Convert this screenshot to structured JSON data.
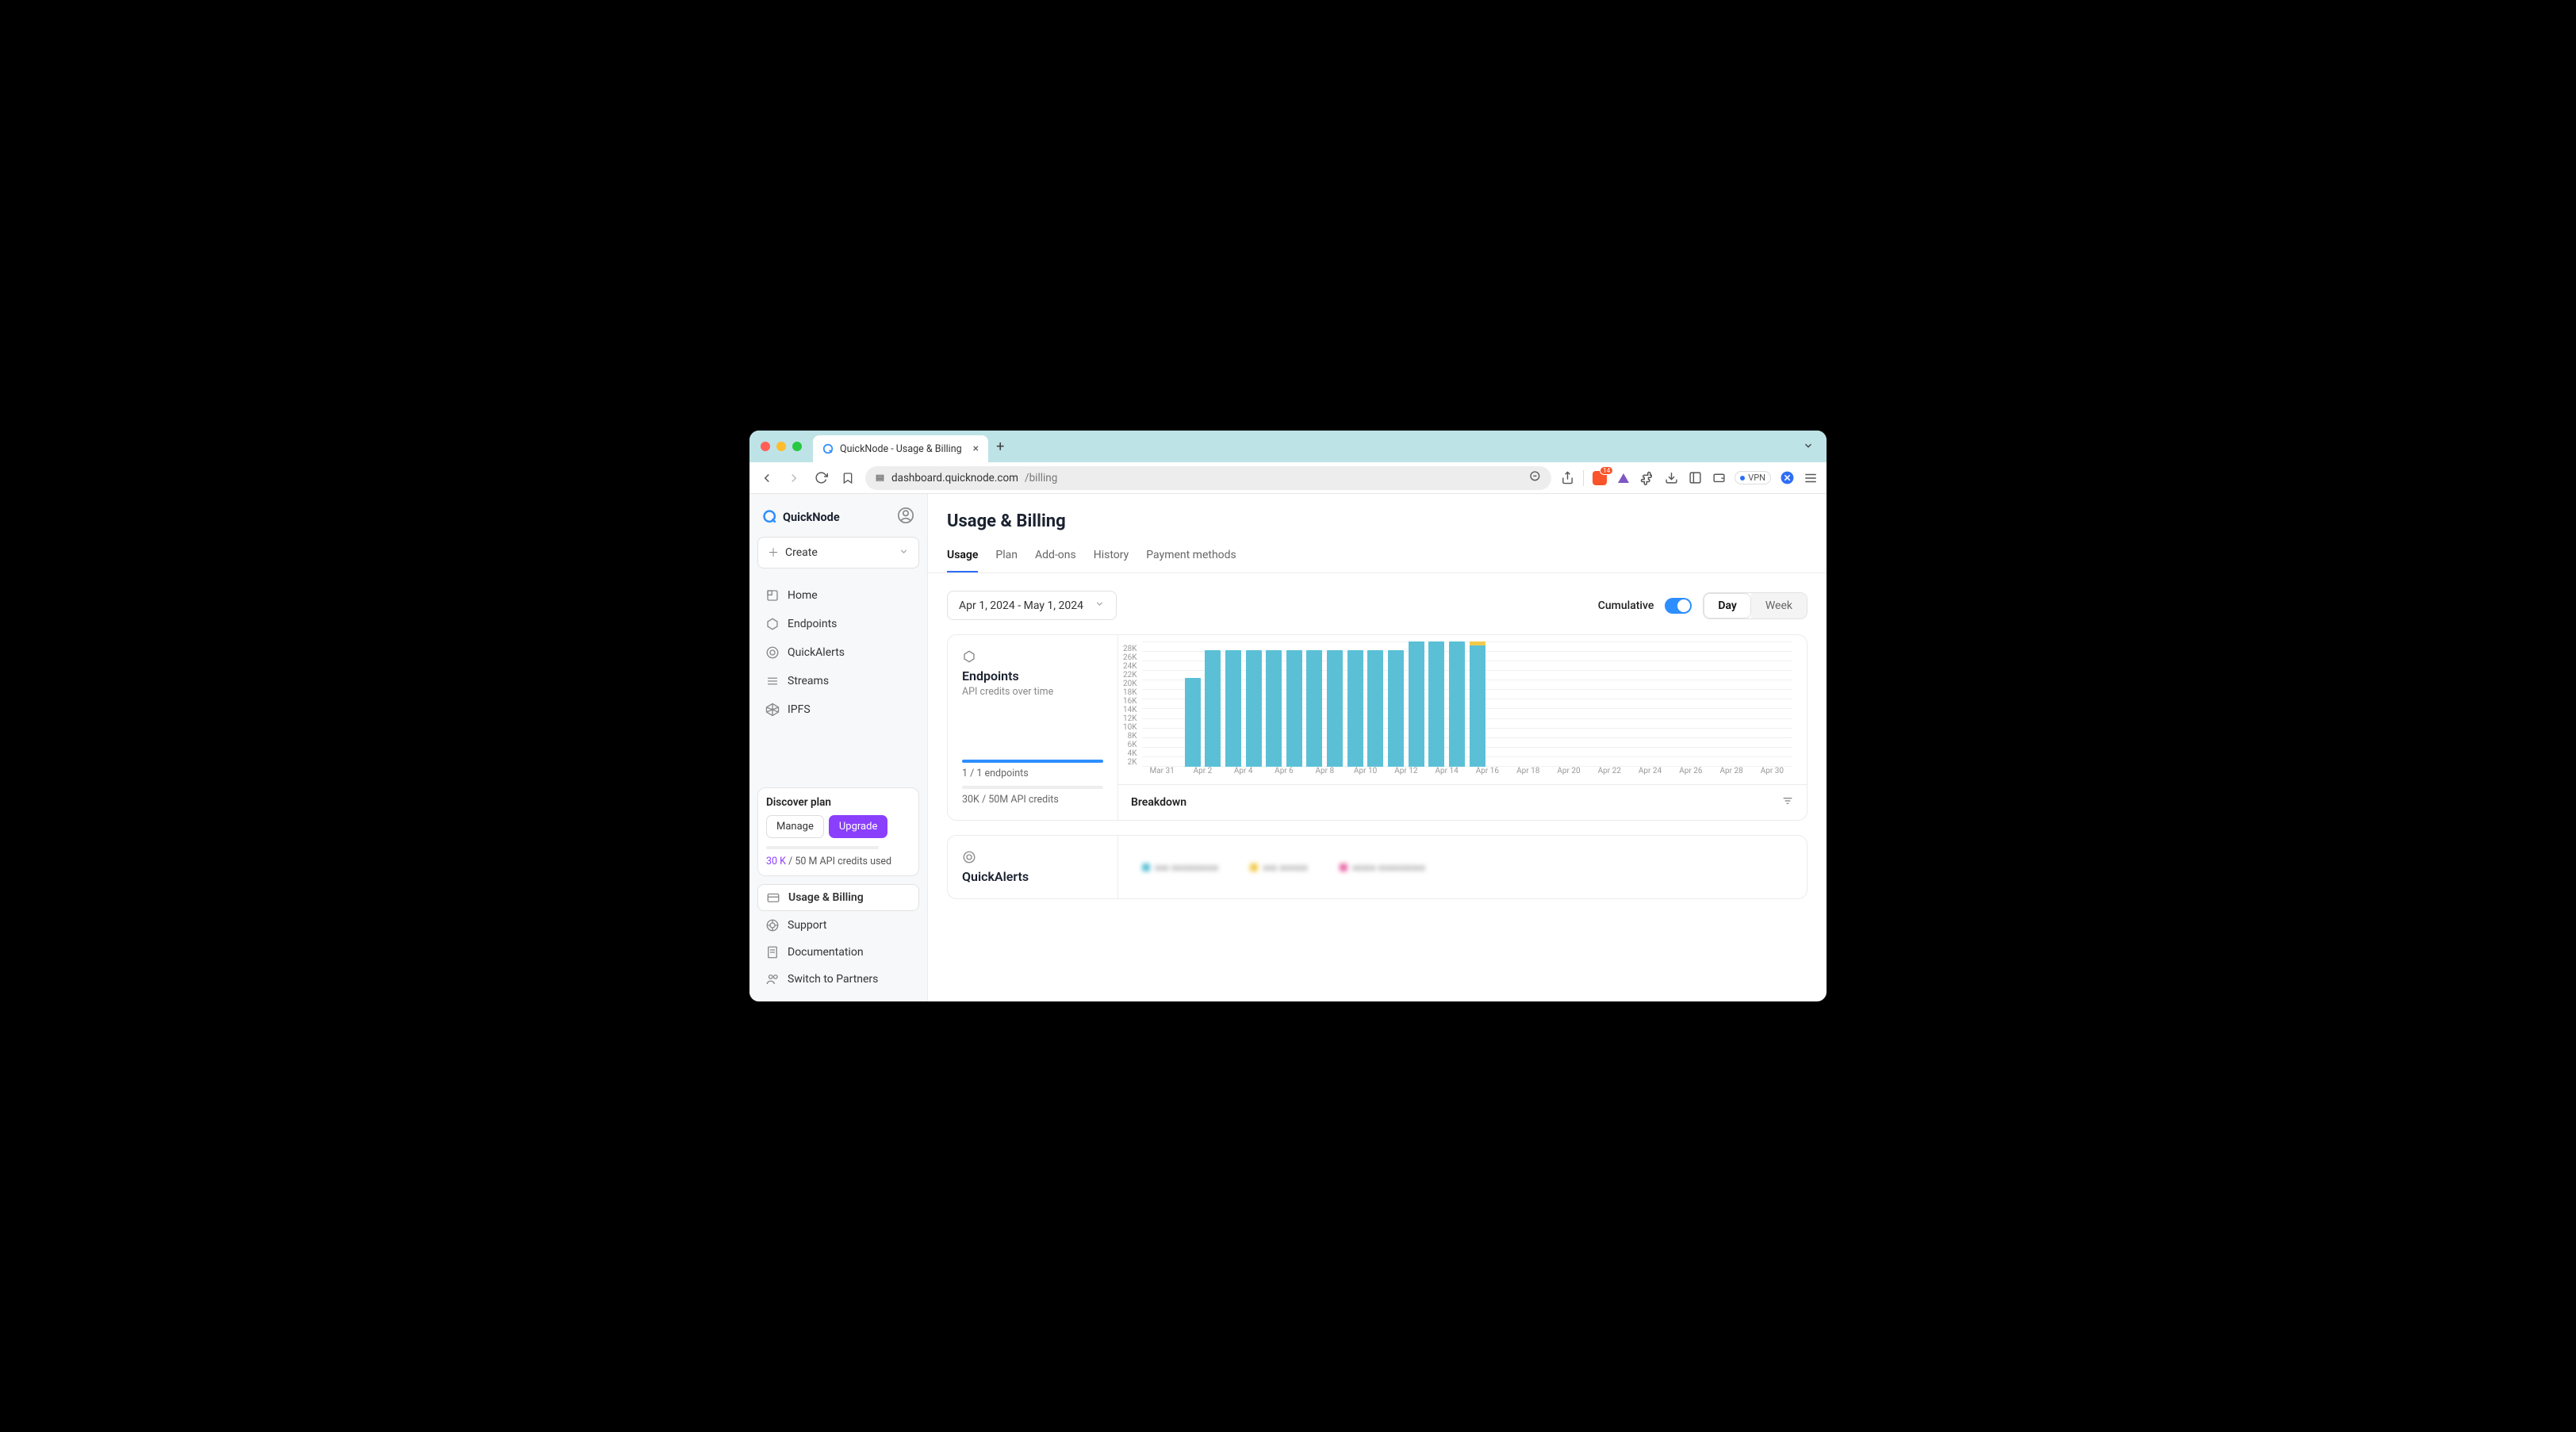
{
  "browser": {
    "tab_title": "QuickNode - Usage & Billing",
    "url_host": "dashboard.quicknode.com",
    "url_path": "/billing",
    "vpn_label": "VPN",
    "brave_count": "14"
  },
  "sidebar": {
    "brand": "QuickNode",
    "create_label": "Create",
    "nav": [
      {
        "label": "Home"
      },
      {
        "label": "Endpoints"
      },
      {
        "label": "QuickAlerts"
      },
      {
        "label": "Streams"
      },
      {
        "label": "IPFS"
      }
    ],
    "plan": {
      "title": "Discover plan",
      "manage": "Manage",
      "upgrade": "Upgrade",
      "usage_hl": "30 K",
      "usage_rest": " / 50 M API credits used"
    },
    "bottom": [
      {
        "label": "Usage & Billing",
        "active": true
      },
      {
        "label": "Support"
      },
      {
        "label": "Documentation"
      },
      {
        "label": "Switch to Partners"
      }
    ]
  },
  "main": {
    "title": "Usage & Billing",
    "tabs": [
      {
        "label": "Usage",
        "active": true
      },
      {
        "label": "Plan"
      },
      {
        "label": "Add-ons"
      },
      {
        "label": "History"
      },
      {
        "label": "Payment methods"
      }
    ],
    "daterange": "Apr 1, 2024 - May 1, 2024",
    "cumulative_label": "Cumulative",
    "granularity": {
      "day": "Day",
      "week": "Week"
    },
    "endpoints_card": {
      "title": "Endpoints",
      "subtitle": "API credits over time",
      "progress1": "1 / 1 endpoints",
      "progress2": "30K / 50M API credits",
      "breakdown_label": "Breakdown"
    },
    "quickalerts_card": {
      "title": "QuickAlerts"
    }
  },
  "chart_data": {
    "type": "bar",
    "title": "Endpoints – API credits over time",
    "ylabel": "API credits",
    "xlabel": "",
    "ylim": [
      0,
      29000
    ],
    "y_ticks": [
      "28K",
      "26K",
      "24K",
      "22K",
      "20K",
      "18K",
      "16K",
      "14K",
      "12K",
      "10K",
      "8K",
      "6K",
      "4K",
      "2K"
    ],
    "x_ticks": [
      "Mar 31",
      "Apr 2",
      "Apr 4",
      "Apr 6",
      "Apr 8",
      "Apr 10",
      "Apr 12",
      "Apr 14",
      "Apr 16",
      "Apr 18",
      "Apr 20",
      "Apr 22",
      "Apr 24",
      "Apr 26",
      "Apr 28",
      "Apr 30"
    ],
    "categories": [
      "Apr 1",
      "Apr 2",
      "Apr 3",
      "Apr 4",
      "Apr 5",
      "Apr 6",
      "Apr 7",
      "Apr 8",
      "Apr 9",
      "Apr 10",
      "Apr 11",
      "Apr 12",
      "Apr 13",
      "Apr 14",
      "Apr 15",
      "Apr 16"
    ],
    "values": [
      0,
      20500,
      27000,
      27000,
      27000,
      27000,
      27000,
      27000,
      27000,
      27000,
      27000,
      27000,
      29000,
      29000,
      29000,
      29000
    ],
    "secondary_cap": {
      "index": 15,
      "value": 500
    }
  }
}
